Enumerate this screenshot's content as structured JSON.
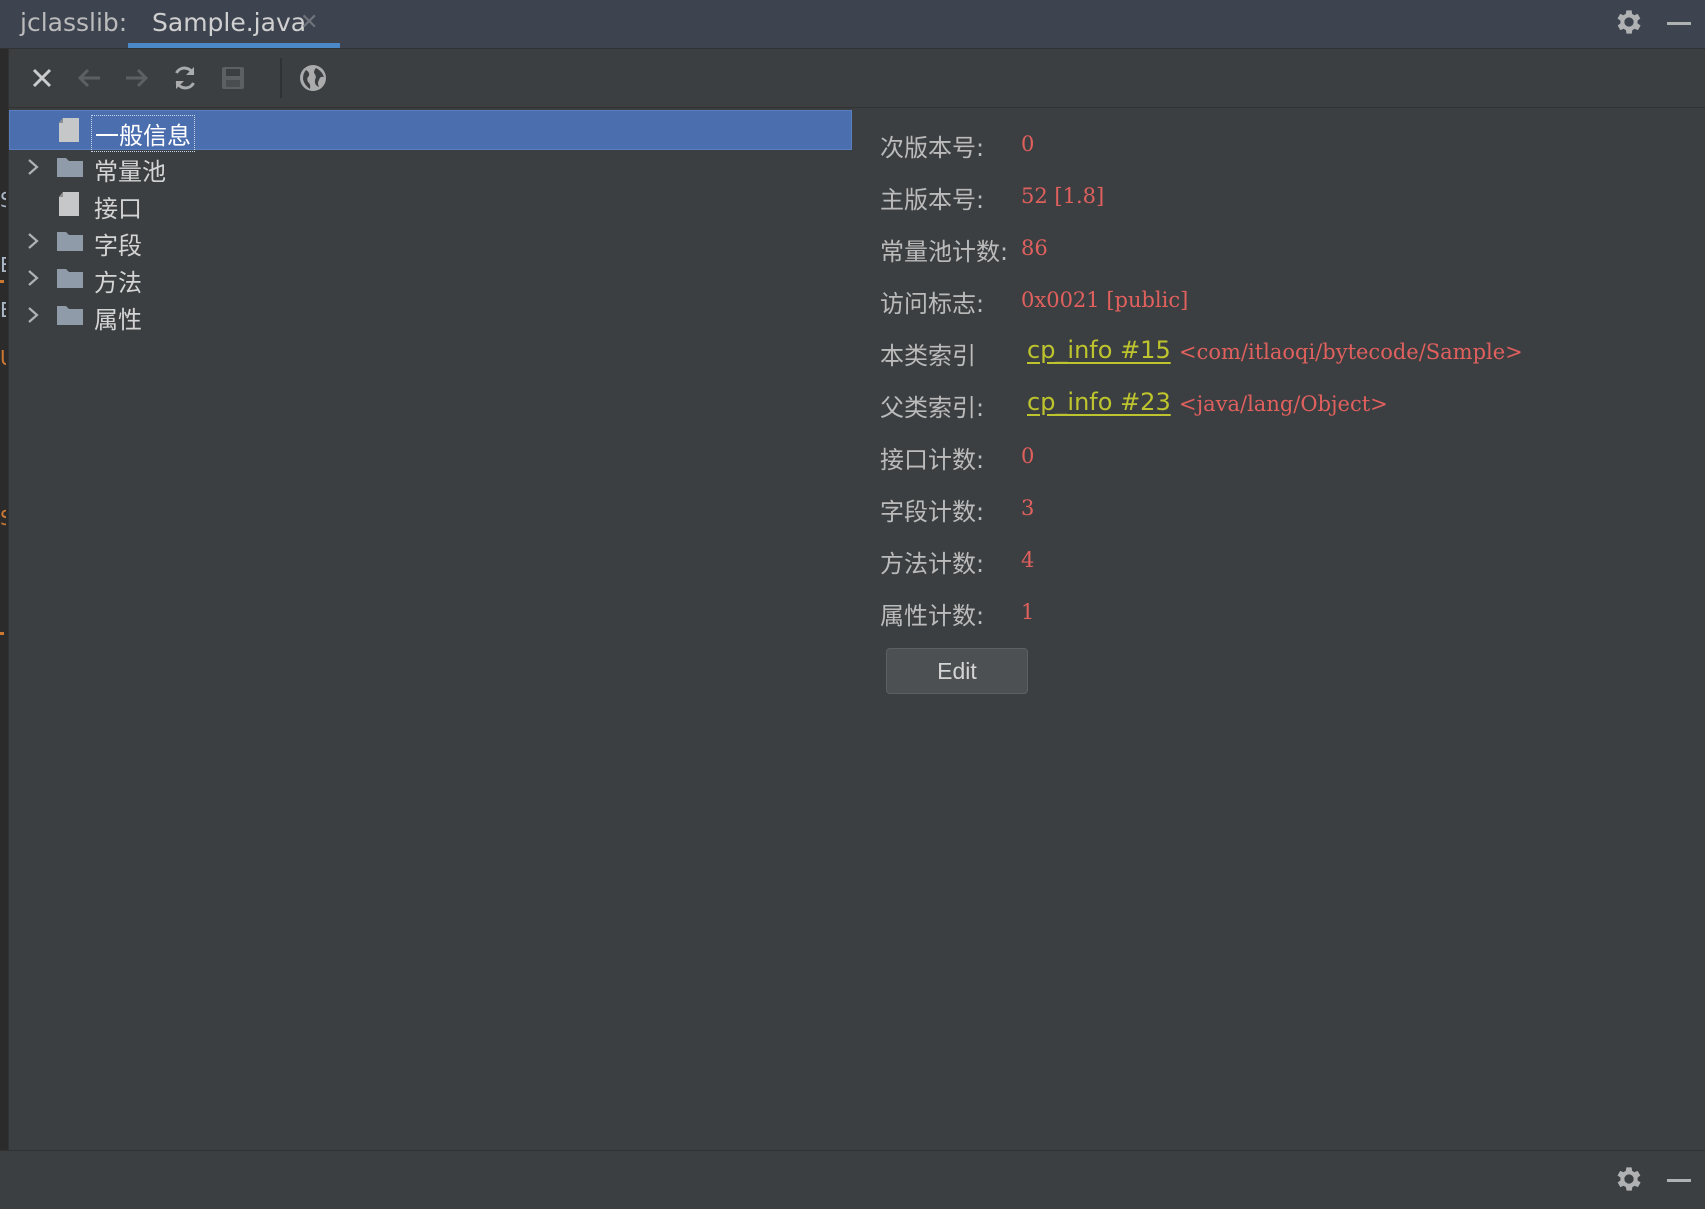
{
  "window": {
    "tool_name": "jclasslib:",
    "tab_label": "Sample.java",
    "tab_close_glyph": "✕",
    "accent_color": "#4a88c7"
  },
  "toolbar": {
    "buttons": [
      {
        "name": "close-icon",
        "enabled": true
      },
      {
        "name": "back-arrow-icon",
        "enabled": false
      },
      {
        "name": "forward-arrow-icon",
        "enabled": false
      },
      {
        "name": "refresh-icon",
        "enabled": true
      },
      {
        "name": "save-icon",
        "enabled": false
      },
      {
        "name": "browser-globe-icon",
        "enabled": true
      }
    ]
  },
  "tree": {
    "items": [
      {
        "label": "一般信息",
        "icon": "file-icon",
        "expandable": false,
        "selected": true
      },
      {
        "label": "常量池",
        "icon": "folder-icon",
        "expandable": true,
        "selected": false
      },
      {
        "label": "接口",
        "icon": "file-icon",
        "expandable": false,
        "selected": false
      },
      {
        "label": "字段",
        "icon": "folder-icon",
        "expandable": true,
        "selected": false
      },
      {
        "label": "方法",
        "icon": "folder-icon",
        "expandable": true,
        "selected": false
      },
      {
        "label": "属性",
        "icon": "folder-icon",
        "expandable": true,
        "selected": false
      }
    ],
    "selection_color": "#4b6eaf"
  },
  "details": {
    "rows": [
      {
        "label": "次版本号:",
        "value": "0"
      },
      {
        "label": "主版本号:",
        "value": "52 [1.8]"
      },
      {
        "label": "常量池计数:",
        "value": "86"
      },
      {
        "label": "访问标志:",
        "value": "0x0021 [public]"
      },
      {
        "label": "本类索引",
        "link": "cp_info #15",
        "desc": "<com/itlaoqi/bytecode/Sample>"
      },
      {
        "label": "父类索引:",
        "link": "cp_info #23",
        "desc": "<java/lang/Object>"
      },
      {
        "label": "接口计数:",
        "value": "0"
      },
      {
        "label": "字段计数:",
        "value": "3"
      },
      {
        "label": "方法计数:",
        "value": "4"
      },
      {
        "label": "属性计数:",
        "value": "1"
      }
    ],
    "edit_label": "Edit",
    "value_color": "#e0605e",
    "link_color": "#bdc42d"
  }
}
